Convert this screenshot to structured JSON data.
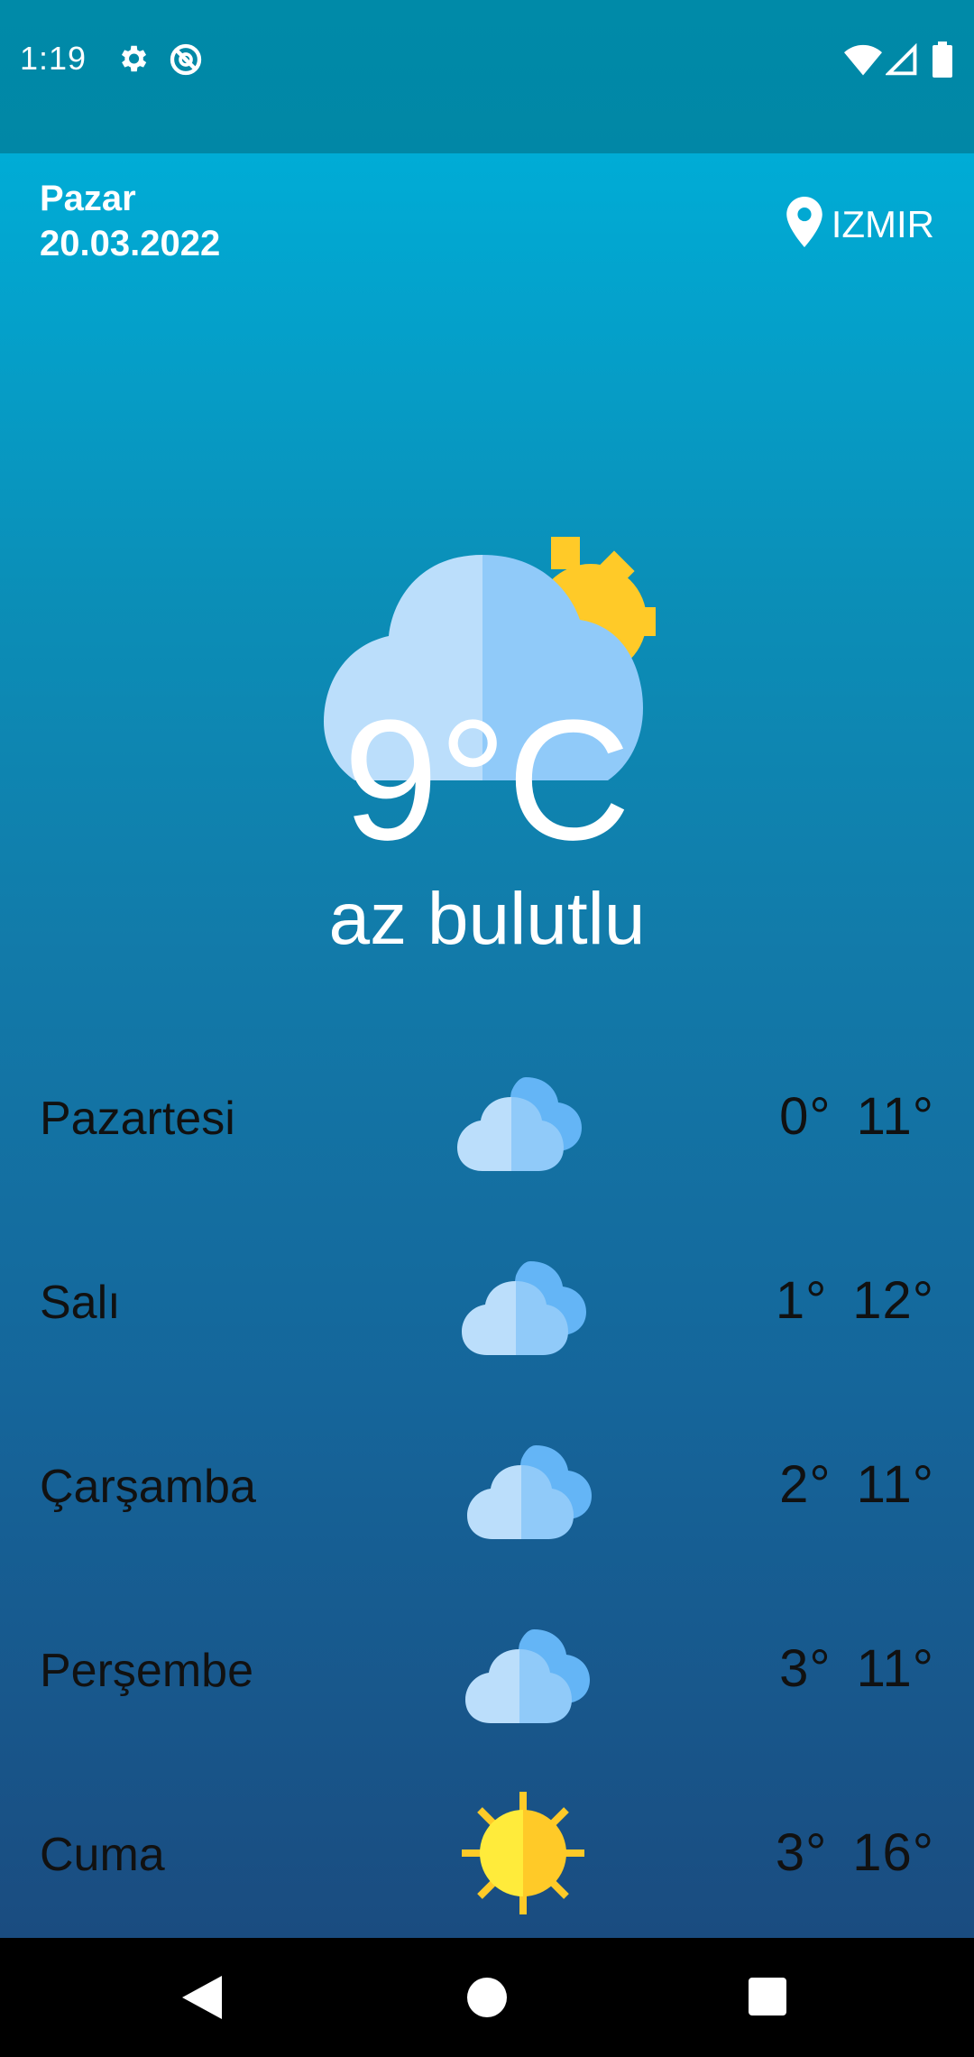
{
  "status_bar": {
    "time": "1:19",
    "icons_left": [
      "gear-icon",
      "no-disturb-icon"
    ],
    "icons_right": [
      "wifi-icon",
      "signal-icon",
      "battery-icon"
    ]
  },
  "header": {
    "day": "Pazar",
    "date": "20.03.2022",
    "location": "IZMIR",
    "location_icon": "map-pin-icon"
  },
  "current": {
    "icon": "partly-cloudy-icon",
    "temperature": "9°C",
    "description": "az bulutlu"
  },
  "forecast": [
    {
      "day": "Pazartesi",
      "icon": "clouds-icon",
      "min": "0°",
      "max": "11°"
    },
    {
      "day": "Salı",
      "icon": "clouds-icon",
      "min": "1°",
      "max": "12°"
    },
    {
      "day": "Çarşamba",
      "icon": "clouds-icon",
      "min": "2°",
      "max": "11°"
    },
    {
      "day": "Perşembe",
      "icon": "clouds-icon",
      "min": "3°",
      "max": "11°"
    },
    {
      "day": "Cuma",
      "icon": "sun-icon",
      "min": "3°",
      "max": "16°"
    }
  ],
  "nav": {
    "buttons": [
      "back-icon",
      "home-icon",
      "recents-icon"
    ]
  },
  "colors": {
    "gradient_top": "#00acd6",
    "gradient_bottom": "#1a4c80",
    "cloud_light": "#bbdefb",
    "cloud_mid": "#90caf9",
    "cloud_dark": "#64b5f6",
    "sun": "#ffd54f",
    "sun_ray": "#ffca28"
  }
}
